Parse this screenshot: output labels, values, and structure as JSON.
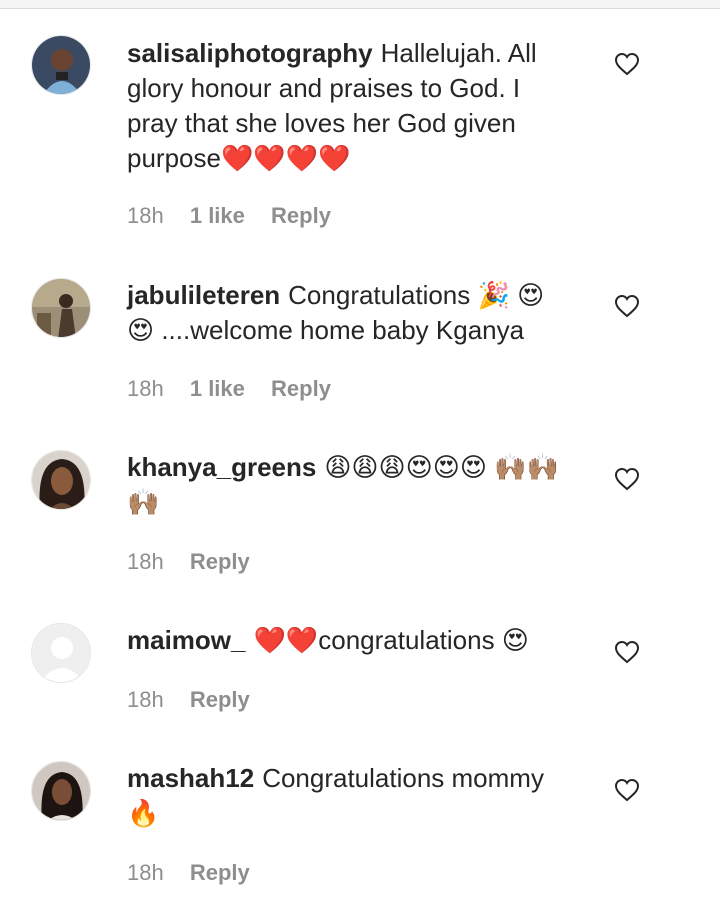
{
  "comments": [
    {
      "username": "salisaliphotography",
      "text": "Hallelujah. All glory honour and praises to God. I pray that she loves her God given purpose❤️❤️❤️❤️",
      "time": "18h",
      "likes": "1 like",
      "reply": "Reply"
    },
    {
      "username": "jabulileteren",
      "text": "Congratulations 🎉 😍 😍 ....welcome home baby Kganya",
      "time": "18h",
      "likes": "1 like",
      "reply": "Reply"
    },
    {
      "username": "khanya_greens",
      "text": "😩😩😩😍😍😍 🙌🏽🙌🏽🙌🏽",
      "time": "18h",
      "likes": "",
      "reply": "Reply"
    },
    {
      "username": "maimow_",
      "text": "❤️❤️congratulations 😍",
      "time": "18h",
      "likes": "",
      "reply": "Reply"
    },
    {
      "username": "mashah12",
      "text": "Congratulations mommy 🔥",
      "time": "18h",
      "likes": "",
      "reply": "Reply"
    }
  ],
  "icons": {
    "like": "heart-outline-icon",
    "avatar_placeholder": "default-avatar-icon"
  },
  "colors": {
    "text": "#262626",
    "meta": "#8e8e8e",
    "background": "#ffffff"
  }
}
